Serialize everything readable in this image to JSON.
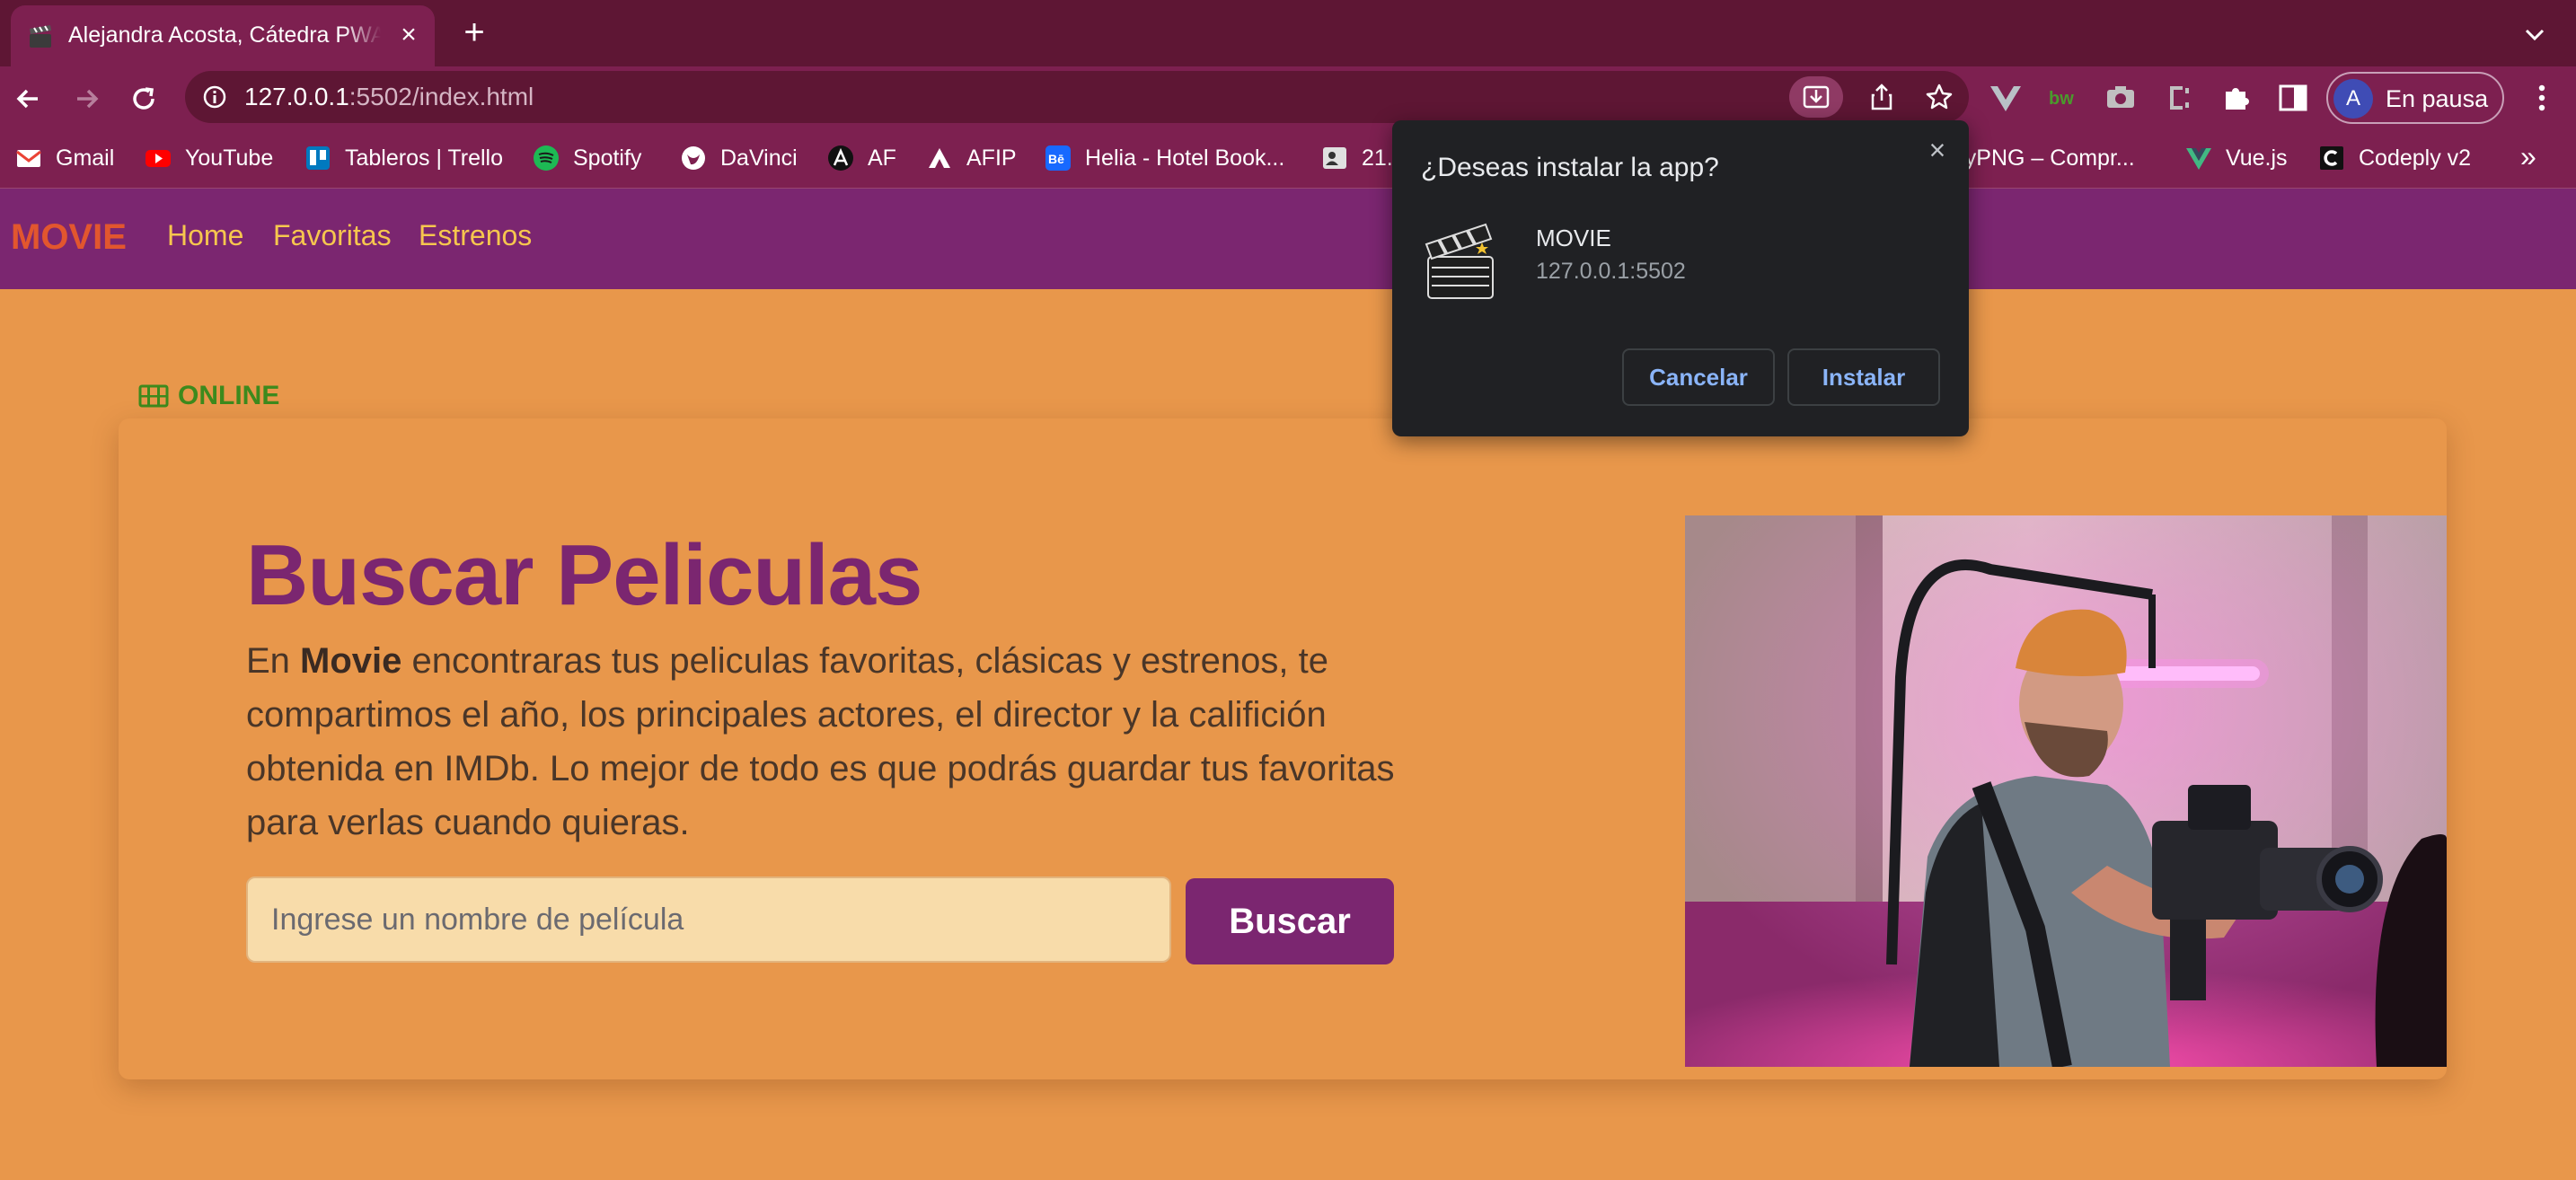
{
  "browser": {
    "tab": {
      "title": "Alejandra Acosta, Cátedra PWA"
    },
    "address": {
      "host": "127.0.0.1",
      "rest": ":5502/index.html"
    },
    "profile": {
      "initial": "A",
      "label": "En pausa"
    },
    "bookmarks": [
      {
        "label": "Gmail",
        "icon": "gmail-icon"
      },
      {
        "label": "YouTube",
        "icon": "youtube-icon"
      },
      {
        "label": "Tableros | Trello",
        "icon": "trello-icon"
      },
      {
        "label": "Spotify",
        "icon": "spotify-icon"
      },
      {
        "label": "DaVinci",
        "icon": "davinci-icon"
      },
      {
        "label": "AF",
        "icon": "af-icon"
      },
      {
        "label": "AFIP",
        "icon": "afip-icon"
      },
      {
        "label": "Helia - Hotel Book...",
        "icon": "behance-icon"
      },
      {
        "label": "21.",
        "icon": "contact-icon"
      },
      {
        "label": "TinyPNG – Compr...",
        "icon": "tinypng-icon"
      },
      {
        "label": "Vue.js",
        "icon": "vue-icon"
      },
      {
        "label": "Codeply v2",
        "icon": "codeply-icon"
      }
    ],
    "bookmarks_overflow": "»"
  },
  "site": {
    "brand": "MOVIE",
    "nav": [
      "Home",
      "Favoritas",
      "Estrenos"
    ],
    "status": "ONLINE",
    "hero": {
      "title": "Buscar Peliculas",
      "text_pre": "En ",
      "text_bold": "Movie",
      "text_post": " encontraras tus peliculas favoritas, clásicas y estrenos, te compartimos el año, los principales actores, el director y la califición obtenida en IMDb. Lo mejor de todo es que podrás guardar tus favoritas para verlas cuando quieras."
    },
    "search": {
      "placeholder": "Ingrese un nombre de película",
      "button": "Buscar"
    }
  },
  "dialog": {
    "title": "¿Deseas instalar la app?",
    "app_name": "MOVIE",
    "origin": "127.0.0.1:5502",
    "cancel": "Cancelar",
    "install": "Instalar"
  },
  "colors": {
    "chrome_dark": "#5e1634",
    "chrome": "#7d2050",
    "page_bg": "#e8974b",
    "nav_bg": "#7b2670",
    "brand": "#e2562e",
    "nav_link": "#f6c64e",
    "online": "#3d8a1d"
  }
}
